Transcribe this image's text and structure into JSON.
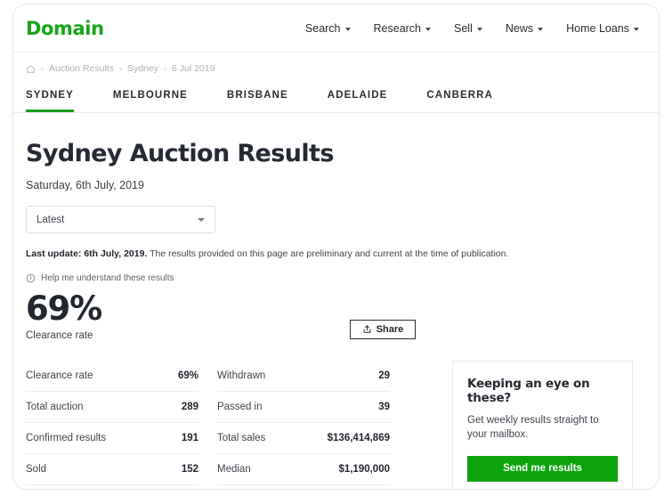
{
  "header": {
    "logo": "Domain",
    "nav": [
      {
        "label": "Search",
        "icon": "chevron-down-icon"
      },
      {
        "label": "Research",
        "icon": "chevron-down-icon"
      },
      {
        "label": "Sell",
        "icon": "chevron-down-icon"
      },
      {
        "label": "News",
        "icon": "chevron-down-icon"
      },
      {
        "label": "Home Loans",
        "icon": "chevron-down-icon"
      }
    ]
  },
  "breadcrumb": {
    "home_icon": "home-icon",
    "separator": "›",
    "items": [
      "Auction Results",
      "Sydney",
      "6 Jul 2019"
    ]
  },
  "tabs": [
    {
      "label": "SYDNEY",
      "active": true
    },
    {
      "label": "MELBOURNE",
      "active": false
    },
    {
      "label": "BRISBANE",
      "active": false
    },
    {
      "label": "ADELAIDE",
      "active": false
    },
    {
      "label": "CANBERRA",
      "active": false
    }
  ],
  "main": {
    "title": "Sydney Auction Results",
    "subtitle": "Saturday, 6th July, 2019",
    "sort_select": {
      "value": "Latest",
      "icon": "chevron-down-icon"
    },
    "last_update_bold": "Last update: 6th July, 2019.",
    "last_update_rest": " The results provided on this page are preliminary and current at the time of publication.",
    "help_link": {
      "label": "Help me understand these results",
      "icon": "info-circle-icon"
    },
    "clearance": {
      "value": "69%",
      "label": "Clearance rate"
    },
    "share_button": {
      "label": "Share",
      "icon": "share-icon"
    }
  },
  "stats_left": [
    {
      "label": "Clearance rate",
      "value": "69%"
    },
    {
      "label": "Total auction",
      "value": "289"
    },
    {
      "label": "Confirmed results",
      "value": "191"
    },
    {
      "label": "Sold",
      "value": "152"
    }
  ],
  "stats_right": [
    {
      "label": "Withdrawn",
      "value": "29"
    },
    {
      "label": "Passed in",
      "value": "39"
    },
    {
      "label": "Total sales",
      "value": "$136,414,869"
    },
    {
      "label": "Median",
      "value": "$1,190,000"
    }
  ],
  "newsletter": {
    "title": "Keeping an eye on these?",
    "text": "Get weekly results straight to your mailbox.",
    "button": "Send me results"
  },
  "colors": {
    "brand_green": "#19a519",
    "button_green": "#0ca40c",
    "tab_underline": "#1a9b1a",
    "text_dark": "#23272f",
    "text_muted": "#adb0b8",
    "border": "#ededf0"
  }
}
